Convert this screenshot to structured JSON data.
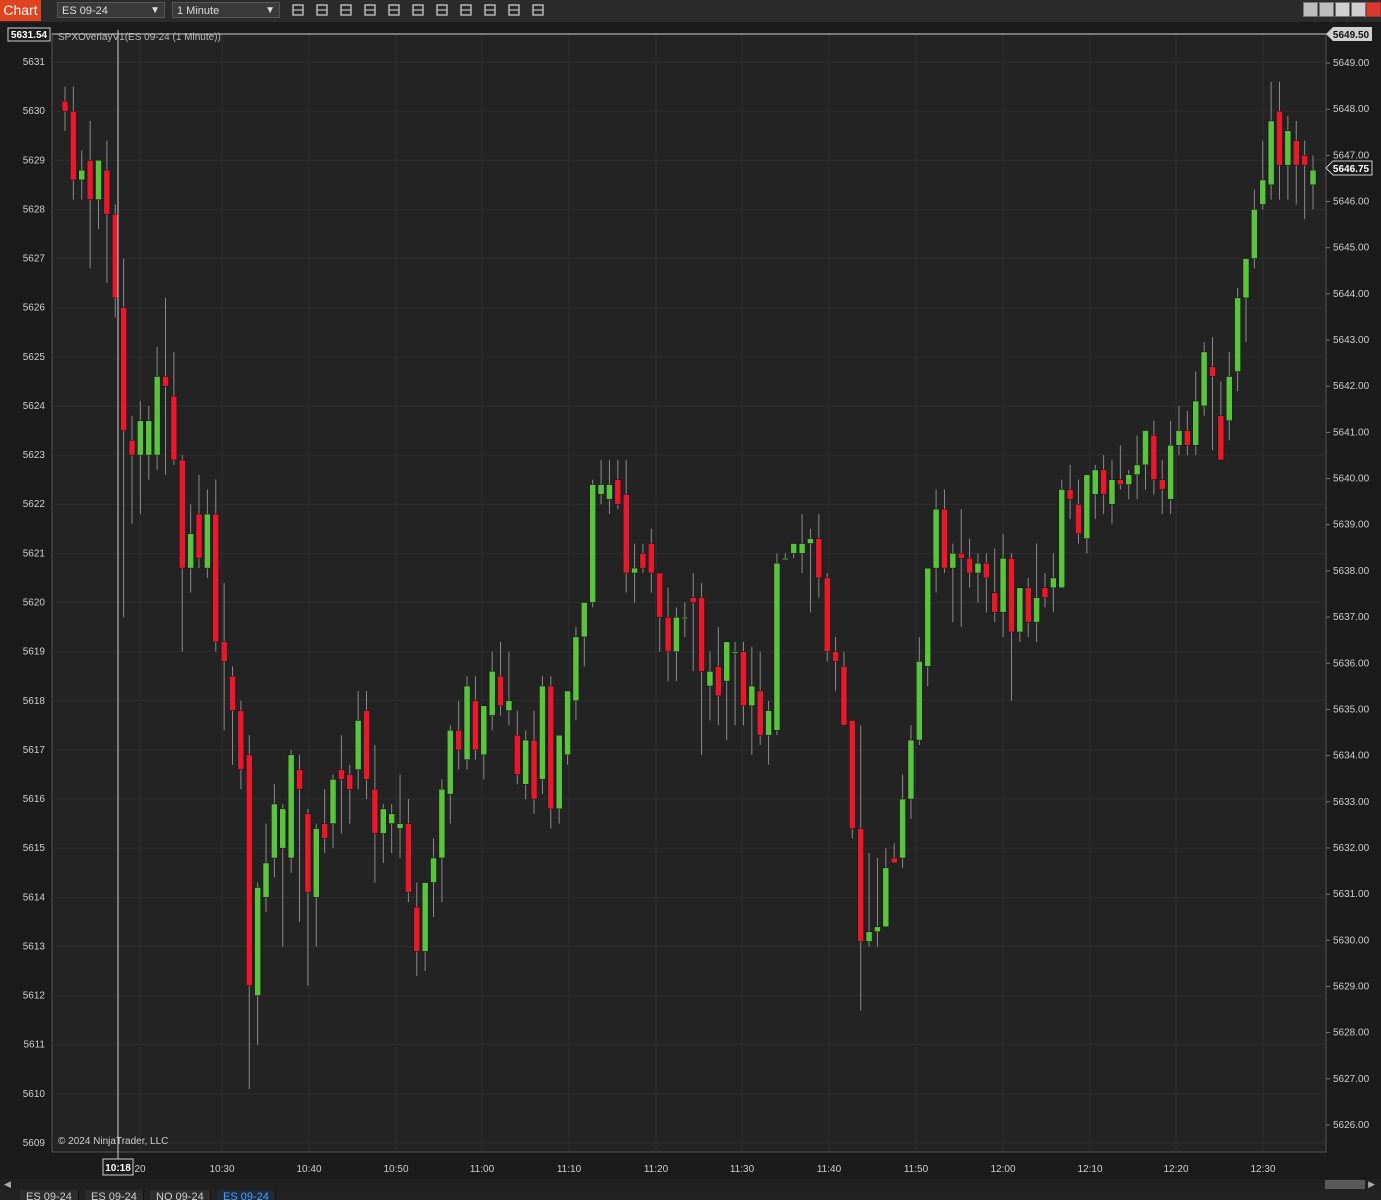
{
  "toolbar": {
    "badge": "Chart",
    "instrument": "ES 09-24",
    "interval": "1 Minute",
    "tools": [
      "bars-type-icon",
      "pencil-icon",
      "zoom-in-icon",
      "zoom-out-icon",
      "crosshair-icon",
      "data-box-icon",
      "chart-trader-icon",
      "properties-icon",
      "strategies-icon",
      "indicator-icon",
      "list-icon"
    ]
  },
  "chart": {
    "title": "SPXOverlayV1(ES 09-24 (1 Minute))",
    "copyright": "© 2024 NinjaTrader, LLC",
    "left_axis_marker": "5631.54",
    "right_axis_marker_top": "5649.50",
    "right_axis_marker_current": "5646.75",
    "time_marker": "10:18",
    "colors": {
      "bg": "#232323",
      "up": "#5ac43c",
      "down": "#e8192d",
      "grid": "#2f2f2f",
      "text": "#cfcfcf"
    }
  },
  "chart_data": {
    "type": "candlestick",
    "left_axis": {
      "ticks": [
        5609,
        5610,
        5611,
        5612,
        5613,
        5614,
        5615,
        5616,
        5617,
        5618,
        5619,
        5620,
        5621,
        5622,
        5623,
        5624,
        5625,
        5626,
        5627,
        5628,
        5629,
        5630,
        5631
      ]
    },
    "right_axis": {
      "ticks": [
        "5626.00",
        "5627.00",
        "5628.00",
        "5629.00",
        "5630.00",
        "5631.00",
        "5632.00",
        "5633.00",
        "5634.00",
        "5635.00",
        "5636.00",
        "5637.00",
        "5638.00",
        "5639.00",
        "5640.00",
        "5641.00",
        "5642.00",
        "5643.00",
        "5644.00",
        "5645.00",
        "5646.00",
        "5647.00",
        "5648.00",
        "5649.00"
      ]
    },
    "x_ticks": [
      "20",
      "10:30",
      "10:40",
      "10:50",
      "11:00",
      "11:10",
      "11:20",
      "11:30",
      "11:40",
      "11:50",
      "12:00",
      "12:10",
      "12:20",
      "12:30"
    ],
    "candles": [
      [
        5630.2,
        5630.5,
        5629.6,
        5630.0
      ],
      [
        5630.0,
        5630.5,
        5628.2,
        5628.6
      ],
      [
        5628.6,
        5629.2,
        5628.2,
        5628.8
      ],
      [
        5629.0,
        5629.8,
        5626.8,
        5628.2
      ],
      [
        5628.2,
        5629.0,
        5627.6,
        5629.0
      ],
      [
        5628.8,
        5629.4,
        5626.5,
        5627.9
      ],
      [
        5627.9,
        5628.1,
        5625.8,
        5626.2
      ],
      [
        5626.0,
        5627.0,
        5619.7,
        5623.5
      ],
      [
        5623.3,
        5623.8,
        5621.6,
        5623.0
      ],
      [
        5623.0,
        5624.1,
        5621.8,
        5623.7
      ],
      [
        5623.0,
        5624.0,
        5622.5,
        5623.7
      ],
      [
        5623.0,
        5625.2,
        5622.7,
        5624.6
      ],
      [
        5624.6,
        5626.2,
        5622.6,
        5624.4
      ],
      [
        5624.2,
        5625.1,
        5622.8,
        5622.9
      ],
      [
        5622.9,
        5623.0,
        5619.0,
        5620.7
      ],
      [
        5620.7,
        5622.0,
        5620.2,
        5621.4
      ],
      [
        5621.8,
        5622.6,
        5620.7,
        5620.9
      ],
      [
        5620.7,
        5622.3,
        5620.5,
        5621.8
      ],
      [
        5621.8,
        5622.5,
        5619.0,
        5619.2
      ],
      [
        5619.2,
        5620.4,
        5617.4,
        5618.8
      ],
      [
        5618.5,
        5618.7,
        5616.7,
        5617.8
      ],
      [
        5617.8,
        5618.0,
        5616.2,
        5616.6
      ],
      [
        5616.9,
        5617.3,
        5610.1,
        5612.2
      ],
      [
        5612.0,
        5614.3,
        5611.0,
        5614.2
      ],
      [
        5614.0,
        5615.5,
        5613.7,
        5614.7
      ],
      [
        5614.8,
        5616.3,
        5614.4,
        5615.9
      ],
      [
        5615.0,
        5615.9,
        5613.0,
        5615.8
      ],
      [
        5614.8,
        5617.0,
        5614.5,
        5616.9
      ],
      [
        5616.6,
        5616.9,
        5613.5,
        5616.2
      ],
      [
        5615.7,
        5615.8,
        5612.2,
        5614.1
      ],
      [
        5614.0,
        5615.5,
        5613.0,
        5615.4
      ],
      [
        5615.5,
        5616.2,
        5614.9,
        5615.2
      ],
      [
        5615.5,
        5616.5,
        5615.0,
        5616.4
      ],
      [
        5616.6,
        5617.3,
        5615.3,
        5616.4
      ],
      [
        5616.5,
        5616.7,
        5615.5,
        5616.2
      ],
      [
        5616.6,
        5618.2,
        5616.2,
        5617.6
      ],
      [
        5617.8,
        5618.2,
        5616.0,
        5616.4
      ],
      [
        5616.2,
        5617.1,
        5614.3,
        5615.3
      ],
      [
        5615.3,
        5615.9,
        5614.7,
        5615.8
      ],
      [
        5615.5,
        5615.9,
        5614.9,
        5615.7
      ],
      [
        5615.4,
        5616.5,
        5614.8,
        5615.5
      ],
      [
        5615.5,
        5616.0,
        5613.9,
        5614.1
      ],
      [
        5613.8,
        5614.3,
        5612.4,
        5612.9
      ],
      [
        5612.9,
        5614.0,
        5612.5,
        5614.3
      ],
      [
        5614.3,
        5615.2,
        5613.6,
        5614.8
      ],
      [
        5614.8,
        5616.4,
        5613.9,
        5616.2
      ],
      [
        5616.1,
        5617.5,
        5615.5,
        5617.4
      ],
      [
        5617.4,
        5618.0,
        5616.6,
        5617.0
      ],
      [
        5616.8,
        5618.5,
        5616.6,
        5618.3
      ],
      [
        5618.0,
        5618.5,
        5616.8,
        5617.0
      ],
      [
        5616.9,
        5617.8,
        5616.4,
        5617.9
      ],
      [
        5617.7,
        5619.0,
        5617.4,
        5618.6
      ],
      [
        5618.5,
        5619.2,
        5617.7,
        5617.9
      ],
      [
        5617.8,
        5619.0,
        5617.5,
        5618.0
      ],
      [
        5617.3,
        5617.8,
        5616.3,
        5616.5
      ],
      [
        5616.3,
        5617.4,
        5616.0,
        5617.2
      ],
      [
        5617.2,
        5617.8,
        5615.7,
        5616.0
      ],
      [
        5616.4,
        5618.5,
        5616.1,
        5618.3
      ],
      [
        5618.3,
        5618.5,
        5615.4,
        5615.8
      ],
      [
        5615.8,
        5617.3,
        5615.5,
        5617.3
      ],
      [
        5616.9,
        5618.0,
        5616.7,
        5618.2
      ],
      [
        5618.0,
        5619.5,
        5617.6,
        5619.3
      ],
      [
        5619.3,
        5620.0,
        5618.7,
        5620.0
      ],
      [
        5620.0,
        5622.5,
        5619.9,
        5622.4
      ],
      [
        5622.2,
        5622.9,
        5622.0,
        5622.4
      ],
      [
        5622.1,
        5622.9,
        5621.8,
        5622.4
      ],
      [
        5622.5,
        5622.9,
        5621.9,
        5622.0
      ],
      [
        5622.2,
        5622.9,
        5620.2,
        5620.6
      ],
      [
        5620.6,
        5621.2,
        5620.0,
        5620.7
      ],
      [
        5621.0,
        5621.2,
        5620.6,
        5620.7
      ],
      [
        5621.2,
        5621.5,
        5620.2,
        5620.6
      ],
      [
        5620.6,
        5620.6,
        5619.0,
        5619.7
      ],
      [
        5619.7,
        5620.3,
        5618.4,
        5619.0
      ],
      [
        5619.0,
        5619.9,
        5618.4,
        5619.7
      ],
      [
        5619.7,
        5620.0,
        5619.3,
        5619.7
      ],
      [
        5620.1,
        5620.6,
        5618.6,
        5620.0
      ],
      [
        5620.1,
        5620.4,
        5616.9,
        5618.6
      ],
      [
        5618.3,
        5619.0,
        5617.6,
        5618.6
      ],
      [
        5618.7,
        5619.5,
        5617.5,
        5618.1
      ],
      [
        5618.4,
        5619.2,
        5617.2,
        5619.2
      ],
      [
        5619.0,
        5619.2,
        5617.5,
        5619.0
      ],
      [
        5619.0,
        5619.2,
        5617.5,
        5617.9
      ],
      [
        5617.9,
        5619.1,
        5616.9,
        5618.3
      ],
      [
        5618.2,
        5619.0,
        5617.1,
        5617.3
      ],
      [
        5617.3,
        5618.0,
        5616.7,
        5617.8
      ],
      [
        5617.4,
        5621.0,
        5617.3,
        5620.8
      ],
      [
        5620.9,
        5621.0,
        5620.9,
        5620.9
      ],
      [
        5621.0,
        5621.1,
        5620.9,
        5621.2
      ],
      [
        5621.0,
        5621.8,
        5620.6,
        5621.2
      ],
      [
        5621.2,
        5621.5,
        5619.8,
        5621.3
      ],
      [
        5621.3,
        5621.8,
        5620.1,
        5620.5
      ],
      [
        5620.5,
        5620.6,
        5618.8,
        5619.0
      ],
      [
        5619.0,
        5619.3,
        5618.2,
        5618.8
      ],
      [
        5618.7,
        5619.0,
        5617.5,
        5617.5
      ],
      [
        5617.6,
        5617.4,
        5615.2,
        5615.4
      ],
      [
        5615.4,
        5617.5,
        5611.7,
        5613.1
      ],
      [
        5613.1,
        5614.9,
        5613.0,
        5613.3
      ],
      [
        5613.3,
        5614.8,
        5613.0,
        5613.4
      ],
      [
        5613.4,
        5615.0,
        5613.4,
        5614.6
      ],
      [
        5614.8,
        5615.1,
        5614.7,
        5614.7
      ],
      [
        5614.8,
        5616.5,
        5614.6,
        5616.0
      ],
      [
        5616.0,
        5617.5,
        5615.6,
        5617.2
      ],
      [
        5617.2,
        5619.3,
        5617.1,
        5618.8
      ],
      [
        5618.7,
        5620.6,
        5618.3,
        5620.7
      ],
      [
        5620.7,
        5622.3,
        5620.2,
        5621.9
      ],
      [
        5621.9,
        5622.3,
        5620.6,
        5620.7
      ],
      [
        5620.7,
        5621.2,
        5619.6,
        5621.0
      ],
      [
        5621.0,
        5621.9,
        5619.5,
        5620.9
      ],
      [
        5620.9,
        5621.3,
        5620.3,
        5620.6
      ],
      [
        5620.6,
        5621.0,
        5620.0,
        5620.8
      ],
      [
        5620.8,
        5621.0,
        5619.8,
        5620.5
      ],
      [
        5620.2,
        5621.1,
        5619.6,
        5619.8
      ],
      [
        5619.8,
        5621.4,
        5619.3,
        5620.9
      ],
      [
        5620.9,
        5621.0,
        5618.0,
        5619.4
      ],
      [
        5619.4,
        5620.1,
        5619.2,
        5620.3
      ],
      [
        5620.3,
        5620.5,
        5619.3,
        5619.6
      ],
      [
        5619.6,
        5621.2,
        5619.2,
        5620.1
      ],
      [
        5620.3,
        5620.6,
        5619.9,
        5620.1
      ],
      [
        5620.3,
        5621.0,
        5619.8,
        5620.5
      ],
      [
        5620.3,
        5622.5,
        5620.3,
        5622.3
      ],
      [
        5622.3,
        5622.8,
        5621.7,
        5622.1
      ],
      [
        5622.0,
        5622.5,
        5621.2,
        5621.4
      ],
      [
        5621.3,
        5622.2,
        5621.0,
        5622.6
      ],
      [
        5622.2,
        5622.8,
        5621.7,
        5622.7
      ],
      [
        5622.7,
        5623.0,
        5621.8,
        5622.2
      ],
      [
        5622.0,
        5622.9,
        5621.6,
        5622.5
      ],
      [
        5622.5,
        5623.2,
        5622.3,
        5622.4
      ],
      [
        5622.4,
        5622.7,
        5622.1,
        5622.6
      ],
      [
        5622.6,
        5623.4,
        5622.1,
        5622.8
      ],
      [
        5622.8,
        5623.5,
        5622.3,
        5623.5
      ],
      [
        5623.4,
        5623.7,
        5622.2,
        5622.5
      ],
      [
        5622.5,
        5622.9,
        5621.8,
        5622.3
      ],
      [
        5622.1,
        5623.7,
        5621.8,
        5623.2
      ],
      [
        5623.2,
        5624.0,
        5623.0,
        5623.5
      ],
      [
        5623.5,
        5623.9,
        5623.0,
        5623.2
      ],
      [
        5623.2,
        5624.7,
        5623.0,
        5624.1
      ],
      [
        5624.0,
        5625.3,
        5623.8,
        5625.1
      ],
      [
        5624.8,
        5625.4,
        5623.1,
        5624.6
      ],
      [
        5623.8,
        5624.5,
        5622.9,
        5622.9
      ],
      [
        5623.7,
        5625.1,
        5623.3,
        5624.6
      ],
      [
        5624.7,
        5626.4,
        5624.3,
        5626.2
      ],
      [
        5626.2,
        5626.8,
        5625.3,
        5627.0
      ],
      [
        5627.0,
        5628.4,
        5626.8,
        5628.0
      ],
      [
        5628.1,
        5629.4,
        5628.0,
        5628.6
      ],
      [
        5628.5,
        5630.6,
        5628.2,
        5629.8
      ],
      [
        5630.0,
        5630.6,
        5628.2,
        5628.9
      ],
      [
        5628.9,
        5629.9,
        5628.2,
        5629.6
      ],
      [
        5629.4,
        5629.8,
        5628.1,
        5628.9
      ],
      [
        5629.1,
        5629.4,
        5627.8,
        5628.9
      ],
      [
        5628.5,
        5629.1,
        5628.0,
        5628.8
      ]
    ]
  },
  "bottom_tabs": [
    "ES 09-24",
    "ES 09-24",
    "NQ 09-24",
    "ES 09-24"
  ]
}
